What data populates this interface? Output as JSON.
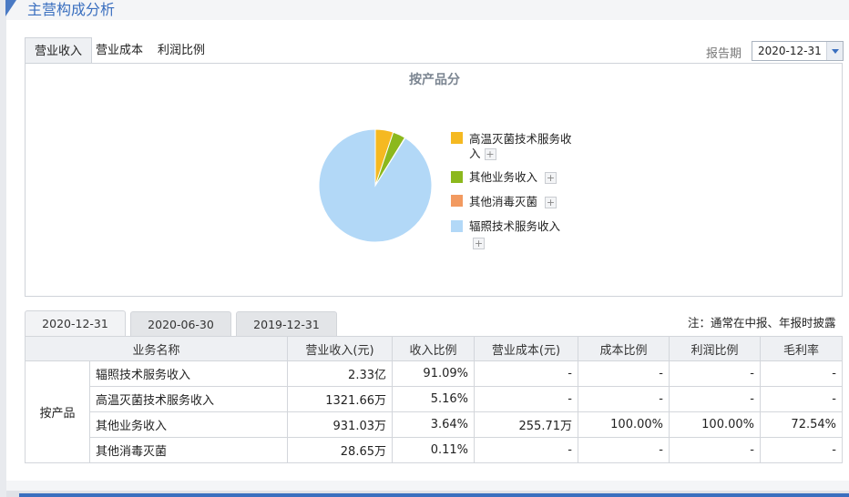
{
  "section_title": "主营构成分析",
  "tabs": [
    {
      "label": "营业收入",
      "active": true
    },
    {
      "label": "营业成本",
      "active": false
    },
    {
      "label": "利润比例",
      "active": false
    }
  ],
  "report_period": {
    "label": "报告期",
    "value": "2020-12-31"
  },
  "chart_data": {
    "type": "pie",
    "title": "按产品分",
    "slices": [
      {
        "label": "高温灭菌技术服务收入",
        "value": 5.16,
        "color": "#f5b921"
      },
      {
        "label": "其他业务收入",
        "value": 3.64,
        "color": "#8cb81d"
      },
      {
        "label": "其他消毒灭菌",
        "value": 0.11,
        "color": "#f29a60"
      },
      {
        "label": "辐照技术服务收入",
        "value": 91.09,
        "color": "#b2d8f7"
      }
    ]
  },
  "legend": [
    {
      "line1": "高温灭菌技术服务收",
      "line2": "入",
      "plus": "+"
    },
    {
      "line1": "其他业务收入",
      "line2": "",
      "plus": "+"
    },
    {
      "line1": "其他消毒灭菌",
      "line2": "",
      "plus": "+"
    },
    {
      "line1": "辐照技术服务收入",
      "line2": "",
      "plus": "+"
    }
  ],
  "date_tabs": [
    "2020-12-31",
    "2020-06-30",
    "2019-12-31"
  ],
  "note": "注：通常在中报、年报时披露",
  "table": {
    "headers": [
      "业务名称",
      "营业收入(元)",
      "收入比例",
      "营业成本(元)",
      "成本比例",
      "利润比例",
      "毛利率"
    ],
    "group": "按产品",
    "rows": [
      [
        "辐照技术服务收入",
        "2.33亿",
        "91.09%",
        "-",
        "-",
        "-",
        "-"
      ],
      [
        "高温灭菌技术服务收入",
        "1321.66万",
        "5.16%",
        "-",
        "-",
        "-",
        "-"
      ],
      [
        "其他业务收入",
        "931.03万",
        "3.64%",
        "255.71万",
        "100.00%",
        "100.00%",
        "72.54%"
      ],
      [
        "其他消毒灭菌",
        "28.65万",
        "0.11%",
        "-",
        "-",
        "-",
        "-"
      ]
    ]
  }
}
